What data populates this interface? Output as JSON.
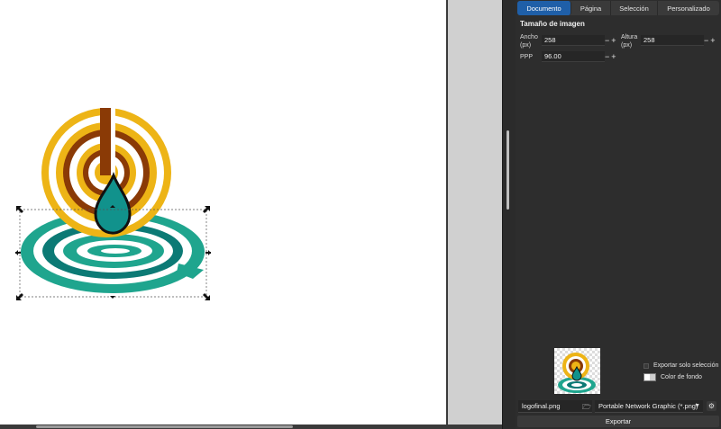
{
  "tabs": [
    "Documento",
    "Página",
    "Selección",
    "Personalizado"
  ],
  "active_tab": "Documento",
  "image_size": {
    "title": "Tamaño de imagen",
    "width_label": "Ancho\n(px)",
    "width_value": "258",
    "height_label": "Altura\n(px)",
    "height_value": "258",
    "dpi_label": "PPP",
    "dpi_value": "96.00",
    "stepper": "−+"
  },
  "options": {
    "export_selection_only": "Exportar solo selección",
    "background_color": "Color de fondo"
  },
  "export": {
    "filename": "logofinal.png",
    "format": "Portable Network Graphic (*.png)",
    "button": "Exportar"
  },
  "icons": {
    "folder": "folder-icon",
    "gear": "gear-icon",
    "dropdown": "chevron-down-icon",
    "grip": "grip-icon"
  },
  "colors": {
    "artwork_yellow": "#EDB416",
    "artwork_brown": "#8A3A06",
    "artwork_teal": "#1FA58E",
    "artwork_dark_teal": "#0C7A75",
    "artwork_drop": "#11928C",
    "tab_active": "#1F5FA8",
    "panel_bg": "#2D2D2D"
  }
}
